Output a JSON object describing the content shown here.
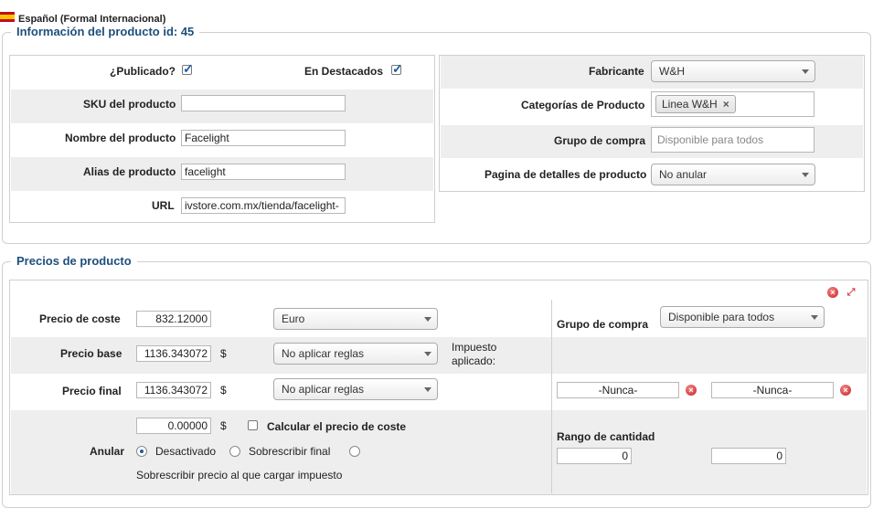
{
  "language": {
    "label": "Español (Formal Internacional)",
    "flag_icon": "spain-flag-icon"
  },
  "product_info": {
    "legend": "Información del producto id: 45",
    "published_label": "¿Publicado?",
    "published_checked": true,
    "featured_label": "En Destacados",
    "featured_checked": true,
    "sku_label": "SKU del producto",
    "sku_value": "",
    "name_label": "Nombre del producto",
    "name_value": "Facelight",
    "alias_label": "Alias de producto",
    "alias_value": "facelight",
    "url_label": "URL",
    "url_value": "ivstore.com.mx/tienda/facelight-",
    "manufacturer_label": "Fabricante",
    "manufacturer_value": "W&H",
    "categories_label": "Categorías de Producto",
    "categories": [
      "Linea W&H"
    ],
    "shopper_group_label": "Grupo de compra",
    "shopper_group_placeholder": "Disponible para todos",
    "details_page_label": "Pagina de detalles de producto",
    "details_page_value": "No anular"
  },
  "prices": {
    "legend": "Precios de producto",
    "cost_label": "Precio de coste",
    "cost_value": "832.12000",
    "currency_value": "Euro",
    "base_label": "Precio base",
    "base_value": "1136.343072",
    "base_unit": "$",
    "base_rule_value": "No aplicar reglas",
    "tax_applied_label": "Impuesto aplicado:",
    "final_label": "Precio final",
    "final_value": "1136.343072",
    "final_unit": "$",
    "final_rule_value": "No aplicar reglas",
    "override_label": "Anular",
    "override_value": "0.00000",
    "override_unit": "$",
    "calc_cost_label": "Calcular el precio de coste",
    "calc_cost_checked": false,
    "radio_disabled_label": "Desactivado",
    "radio_disabled_selected": true,
    "radio_override_final_label": "Sobrescribir final",
    "radio_override_final_selected": false,
    "override_tax_note": "Sobrescribir precio al que cargar impuesto",
    "shopper_group_label": "Grupo de compra",
    "shopper_group_value": "Disponible para todos",
    "date_from_value": "-Nunca-",
    "date_to_value": "-Nunca-",
    "quantity_range_label": "Rango de cantidad",
    "quantity_from_value": "0",
    "quantity_to_value": "0"
  }
}
